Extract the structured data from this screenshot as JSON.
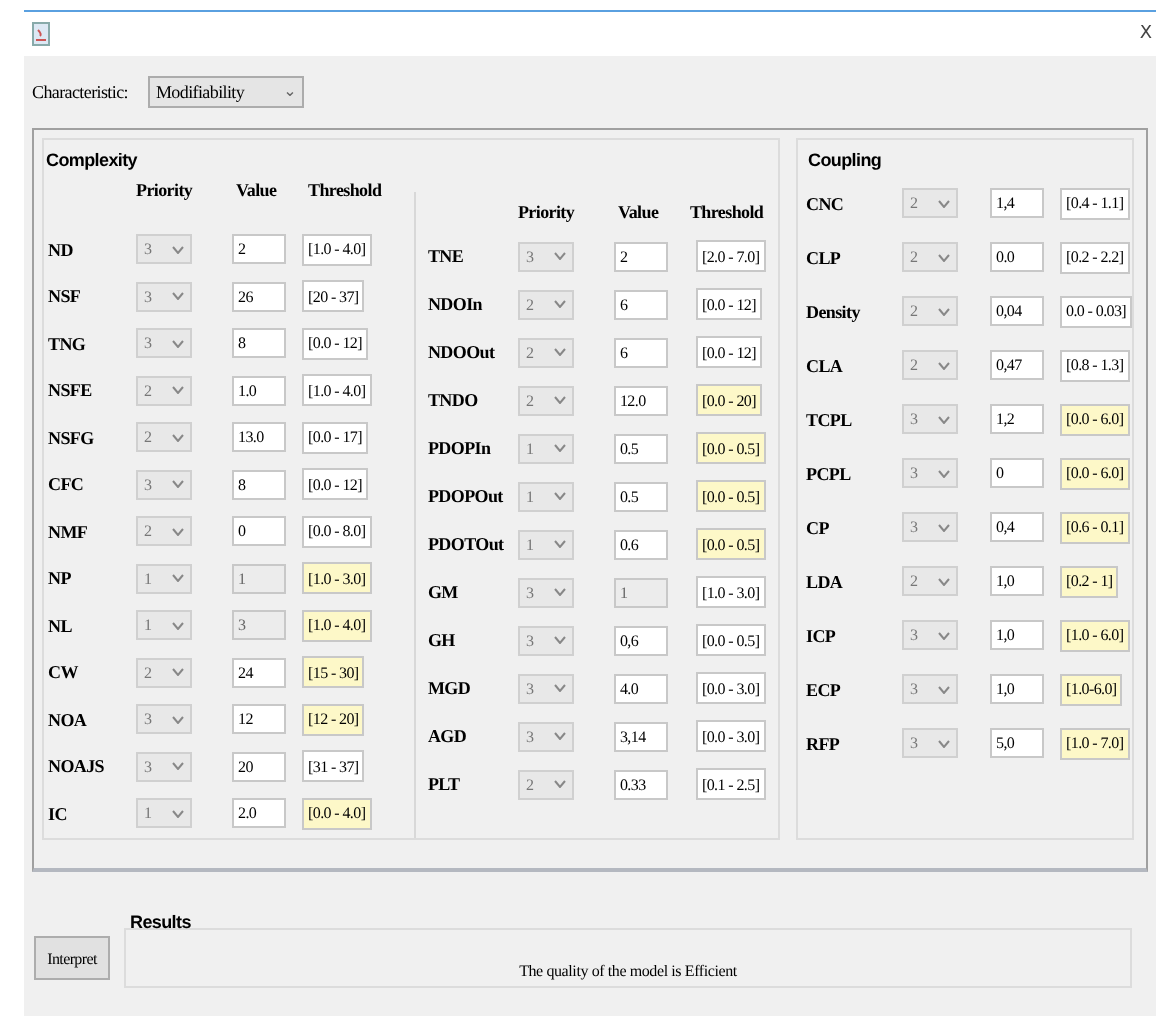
{
  "window": {
    "close": "X"
  },
  "characteristic": {
    "label": "Characteristic:",
    "value": "Modifiability",
    "caret": "⌄"
  },
  "complexity": {
    "title": "Complexity",
    "columns": [
      {
        "headers": [
          "Priority",
          "Value",
          "Threshold"
        ],
        "rows": [
          {
            "name": "ND",
            "priority": "3",
            "value": "2",
            "threshold": "[1.0 - 4.0]",
            "value_disabled": false,
            "highlighted": false
          },
          {
            "name": "NSF",
            "priority": "3",
            "value": "26",
            "threshold": "[20 - 37]",
            "value_disabled": false,
            "highlighted": false
          },
          {
            "name": "TNG",
            "priority": "3",
            "value": "8",
            "threshold": "[0.0 - 12]",
            "value_disabled": false,
            "highlighted": false
          },
          {
            "name": "NSFE",
            "priority": "2",
            "value": "1.0",
            "threshold": "[1.0 - 4.0]",
            "value_disabled": false,
            "highlighted": false
          },
          {
            "name": "NSFG",
            "priority": "2",
            "value": "13.0",
            "threshold": "[0.0 - 17]",
            "value_disabled": false,
            "highlighted": false
          },
          {
            "name": "CFC",
            "priority": "3",
            "value": "8",
            "threshold": "[0.0 - 12]",
            "value_disabled": false,
            "highlighted": false
          },
          {
            "name": "NMF",
            "priority": "2",
            "value": "0",
            "threshold": "[0.0 - 8.0]",
            "value_disabled": false,
            "highlighted": false
          },
          {
            "name": "NP",
            "priority": "1",
            "value": "1",
            "threshold": "[1.0 - 3.0]",
            "value_disabled": true,
            "highlighted": true
          },
          {
            "name": "NL",
            "priority": "1",
            "value": "3",
            "threshold": "[1.0 - 4.0]",
            "value_disabled": true,
            "highlighted": true
          },
          {
            "name": "CW",
            "priority": "2",
            "value": "24",
            "threshold": "[15 - 30]",
            "value_disabled": false,
            "highlighted": true
          },
          {
            "name": "NOA",
            "priority": "3",
            "value": "12",
            "threshold": "[12 - 20]",
            "value_disabled": false,
            "highlighted": true
          },
          {
            "name": "NOAJS",
            "priority": "3",
            "value": "20",
            "threshold": "[31 - 37]",
            "value_disabled": false,
            "highlighted": false
          },
          {
            "name": "IC",
            "priority": "1",
            "value": "2.0",
            "threshold": "[0.0 - 4.0]",
            "value_disabled": false,
            "highlighted": true
          }
        ]
      },
      {
        "headers": [
          "Priority",
          "Value",
          "Threshold"
        ],
        "rows": [
          {
            "name": "TNE",
            "priority": "3",
            "value": "2",
            "threshold": "[2.0 - 7.0]",
            "value_disabled": false,
            "highlighted": false
          },
          {
            "name": "NDOIn",
            "priority": "2",
            "value": "6",
            "threshold": "[0.0 - 12]",
            "value_disabled": false,
            "highlighted": false
          },
          {
            "name": "NDOOut",
            "priority": "2",
            "value": "6",
            "threshold": "[0.0 - 12]",
            "value_disabled": false,
            "highlighted": false
          },
          {
            "name": "TNDO",
            "priority": "2",
            "value": "12.0",
            "threshold": "[0.0 - 20]",
            "value_disabled": false,
            "highlighted": true
          },
          {
            "name": "PDOPIn",
            "priority": "1",
            "value": "0.5",
            "threshold": "[0.0 - 0.5]",
            "value_disabled": false,
            "highlighted": true
          },
          {
            "name": "PDOPOut",
            "priority": "1",
            "value": "0.5",
            "threshold": "[0.0 - 0.5]",
            "value_disabled": false,
            "highlighted": true
          },
          {
            "name": "PDOTOut",
            "priority": "1",
            "value": "0.6",
            "threshold": "[0.0 - 0.5]",
            "value_disabled": false,
            "highlighted": true
          },
          {
            "name": "GM",
            "priority": "3",
            "value": "1",
            "threshold": "[1.0 - 3.0]",
            "value_disabled": true,
            "highlighted": false
          },
          {
            "name": "GH",
            "priority": "3",
            "value": "0,6",
            "threshold": "[0.0 - 0.5]",
            "value_disabled": false,
            "highlighted": false
          },
          {
            "name": "MGD",
            "priority": "3",
            "value": "4.0",
            "threshold": "[0.0 - 3.0]",
            "value_disabled": false,
            "highlighted": false
          },
          {
            "name": "AGD",
            "priority": "3",
            "value": "3,14",
            "threshold": "[0.0 - 3.0]",
            "value_disabled": false,
            "highlighted": false
          },
          {
            "name": "PLT",
            "priority": "2",
            "value": "0.33",
            "threshold": "[0.1 - 2.5]",
            "value_disabled": false,
            "highlighted": false
          }
        ]
      }
    ]
  },
  "coupling": {
    "title": "Coupling",
    "rows": [
      {
        "name": "CNC",
        "priority": "2",
        "value": "1,4",
        "threshold": "[0.4 - 1.1]",
        "value_disabled": false,
        "highlighted": false
      },
      {
        "name": "CLP",
        "priority": "2",
        "value": "0.0",
        "threshold": "[0.2 - 2.2]",
        "value_disabled": false,
        "highlighted": false
      },
      {
        "name": "Density",
        "priority": "2",
        "value": "0,04",
        "threshold": "0.0 - 0.03]",
        "value_disabled": false,
        "highlighted": false
      },
      {
        "name": "CLA",
        "priority": "2",
        "value": "0,47",
        "threshold": "[0.8 - 1.3]",
        "value_disabled": false,
        "highlighted": false
      },
      {
        "name": "TCPL",
        "priority": "3",
        "value": "1,2",
        "threshold": "[0.0 - 6.0]",
        "value_disabled": false,
        "highlighted": true
      },
      {
        "name": "PCPL",
        "priority": "3",
        "value": "0",
        "threshold": "[0.0 - 6.0]",
        "value_disabled": false,
        "highlighted": true
      },
      {
        "name": "CP",
        "priority": "3",
        "value": "0,4",
        "threshold": "[0.6 - 0.1]",
        "value_disabled": false,
        "highlighted": true
      },
      {
        "name": "LDA",
        "priority": "2",
        "value": "1,0",
        "threshold": "[0.2 - 1]",
        "value_disabled": false,
        "highlighted": true
      },
      {
        "name": "ICP",
        "priority": "3",
        "value": "1,0",
        "threshold": "[1.0 - 6.0]",
        "value_disabled": false,
        "highlighted": true
      },
      {
        "name": "ECP",
        "priority": "3",
        "value": "1,0",
        "threshold": "[1.0-6.0]",
        "value_disabled": false,
        "highlighted": true
      },
      {
        "name": "RFP",
        "priority": "3",
        "value": "5,0",
        "threshold": "[1.0 - 7.0]",
        "value_disabled": false,
        "highlighted": true
      }
    ]
  },
  "interpret_button": "Interpret",
  "results": {
    "title": "Results",
    "text": "The quality of the model is Efficient"
  }
}
